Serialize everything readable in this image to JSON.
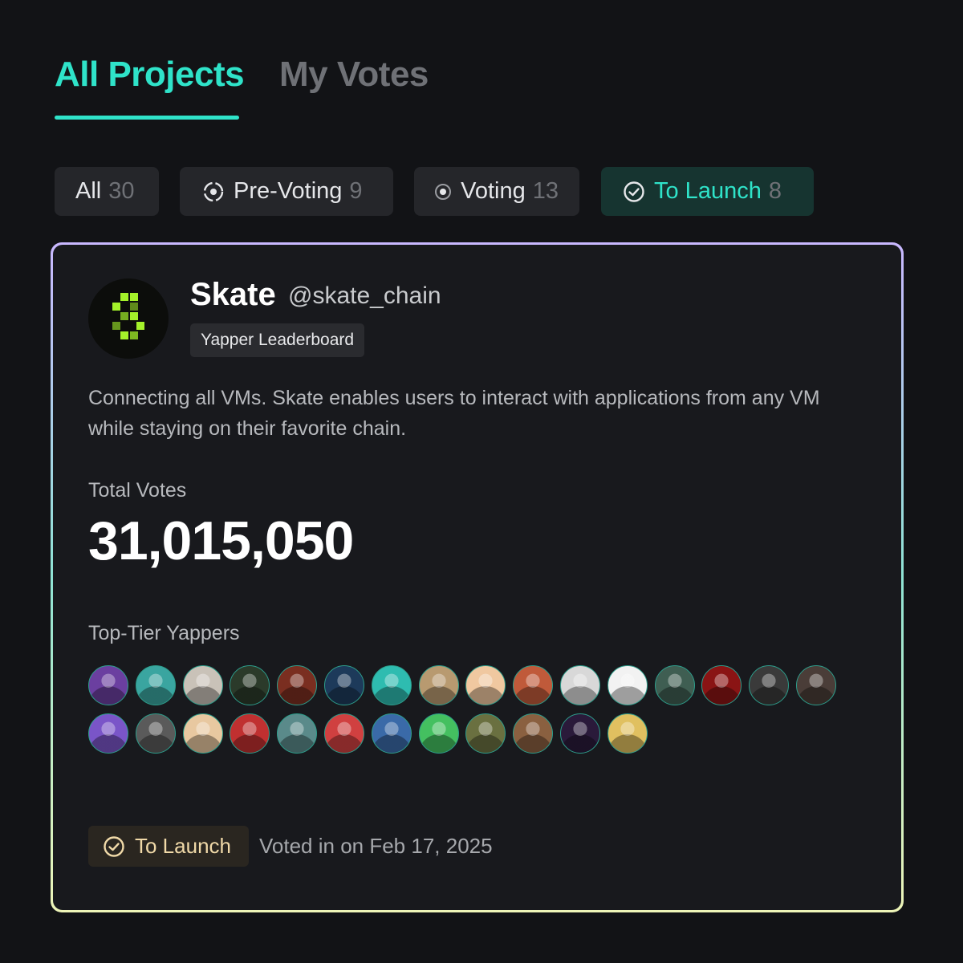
{
  "tabs": {
    "all_projects": "All Projects",
    "my_votes": "My Votes"
  },
  "filters": [
    {
      "label": "All",
      "count": "30",
      "icon": null
    },
    {
      "label": "Pre-Voting",
      "count": "9",
      "icon": "dashed-circle-icon"
    },
    {
      "label": "Voting",
      "count": "13",
      "icon": "radio-dot-icon"
    },
    {
      "label": "To Launch",
      "count": "8",
      "icon": "check-circle-icon",
      "active": true
    }
  ],
  "colors": {
    "accent": "#2fe3c9",
    "launch_badge_text": "#f0d9a8",
    "logo_green": "#a4f22a"
  },
  "project": {
    "name": "Skate",
    "handle": "@skate_chain",
    "tag": "Yapper Leaderboard",
    "description": "Connecting all VMs. Skate enables users to interact with applications from any VM while staying on their favorite chain.",
    "total_votes_label": "Total Votes",
    "total_votes": "31,015,050",
    "yappers_label": "Top-Tier Yappers",
    "yapper_avatar_colors": [
      "#6b3fa0",
      "#3aa5a0",
      "#c9c2b8",
      "#2b3a2a",
      "#7a2e20",
      "#1d3a5a",
      "#2ebcb0",
      "#b89a70",
      "#f0c8a0",
      "#c05a3a",
      "#d8d8d8",
      "#f2f2f2",
      "#3f5e52",
      "#8a1414",
      "#3a3a3a",
      "#4a3d38",
      "#7a55c8",
      "#5a5a5a",
      "#e8c8a0",
      "#c03030",
      "#5a8a8a",
      "#d04040",
      "#3a6aa8",
      "#44c060",
      "#6a7040",
      "#8a6040",
      "#2a1a3a",
      "#e0c060"
    ],
    "status": "To Launch",
    "voted_text": "Voted in on Feb 17, 2025"
  }
}
